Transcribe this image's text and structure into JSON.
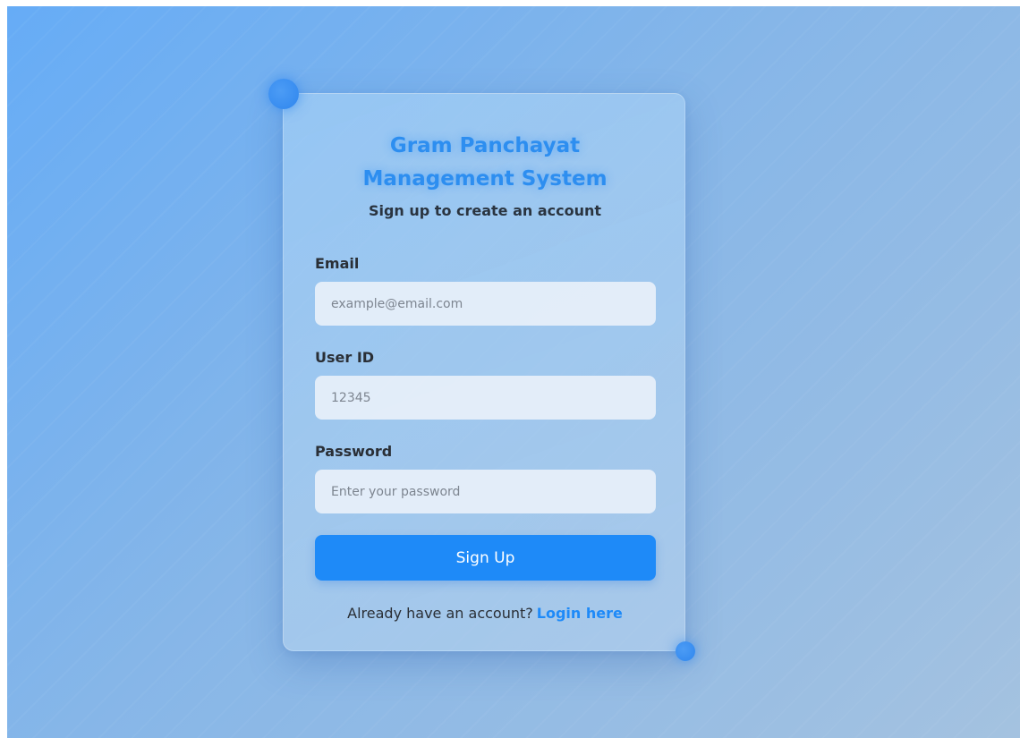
{
  "app": {
    "title_line1": "Gram Panchayat",
    "title_line2": "Management System",
    "subtitle": "Sign up to create an account"
  },
  "form": {
    "email": {
      "label": "Email",
      "placeholder": "example@email.com",
      "value": ""
    },
    "user_id": {
      "label": "User ID",
      "placeholder": "12345",
      "value": ""
    },
    "password": {
      "label": "Password",
      "placeholder": "Enter your password",
      "value": ""
    },
    "submit_label": "Sign Up"
  },
  "footer": {
    "prompt": "Already have an account?",
    "login_link": "Login here"
  },
  "colors": {
    "accent": "#1e8af8",
    "title": "#2d8ef0",
    "background_start": "#66acf6",
    "background_end": "#a4c2e0"
  }
}
